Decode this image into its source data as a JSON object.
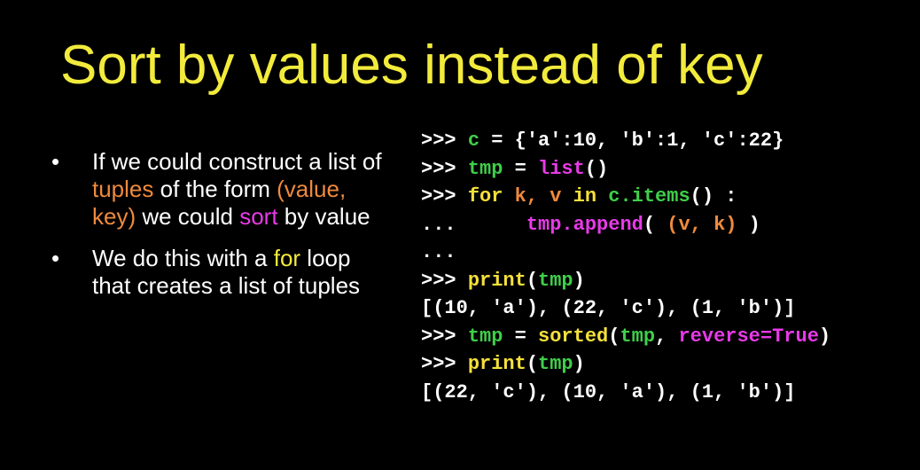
{
  "slide": {
    "title": "Sort by values instead of key",
    "bullets": [
      {
        "parts": [
          {
            "text": "If we could construct a list of ",
            "style": "plain"
          },
          {
            "text": "tuples",
            "style": "orange"
          },
          {
            "text": " of the form ",
            "style": "plain"
          },
          {
            "text": "(value, key)",
            "style": "orange"
          },
          {
            "text": " we could ",
            "style": "plain"
          },
          {
            "text": "sort",
            "style": "magenta"
          },
          {
            "text": " by value",
            "style": "plain"
          }
        ]
      },
      {
        "parts": [
          {
            "text": "We do this with a ",
            "style": "plain"
          },
          {
            "text": "for",
            "style": "yellow"
          },
          {
            "text": " loop that creates a list of tuples",
            "style": "plain"
          }
        ]
      }
    ],
    "bullet_symbol": "•",
    "code_lines": [
      [
        {
          "text": ">>> ",
          "color": "white"
        },
        {
          "text": "c",
          "color": "green"
        },
        {
          "text": " = {'a':10, 'b':1, 'c':22}",
          "color": "white"
        }
      ],
      [
        {
          "text": ">>> ",
          "color": "white"
        },
        {
          "text": "tmp",
          "color": "green"
        },
        {
          "text": " = ",
          "color": "white"
        },
        {
          "text": "list",
          "color": "magenta"
        },
        {
          "text": "()",
          "color": "white"
        }
      ],
      [
        {
          "text": ">>> ",
          "color": "white"
        },
        {
          "text": "for",
          "color": "yellow"
        },
        {
          "text": " ",
          "color": "white"
        },
        {
          "text": "k, v",
          "color": "orange"
        },
        {
          "text": " ",
          "color": "white"
        },
        {
          "text": "in",
          "color": "yellow"
        },
        {
          "text": " ",
          "color": "white"
        },
        {
          "text": "c.items",
          "color": "green"
        },
        {
          "text": "() :",
          "color": "white"
        }
      ],
      [
        {
          "text": "...      ",
          "color": "white"
        },
        {
          "text": "tmp.append",
          "color": "magenta"
        },
        {
          "text": "( ",
          "color": "white"
        },
        {
          "text": "(v, k)",
          "color": "orange"
        },
        {
          "text": " )",
          "color": "white"
        }
      ],
      [
        {
          "text": "...",
          "color": "white"
        }
      ],
      [
        {
          "text": ">>> ",
          "color": "white"
        },
        {
          "text": "print",
          "color": "yellow"
        },
        {
          "text": "(",
          "color": "white"
        },
        {
          "text": "tmp",
          "color": "green"
        },
        {
          "text": ")",
          "color": "white"
        }
      ],
      [
        {
          "text": "[(10, 'a'), (22, 'c'), (1, 'b')]",
          "color": "white"
        }
      ],
      [
        {
          "text": ">>> ",
          "color": "white"
        },
        {
          "text": "tmp",
          "color": "green"
        },
        {
          "text": " = ",
          "color": "white"
        },
        {
          "text": "sorted",
          "color": "yellow"
        },
        {
          "text": "(",
          "color": "white"
        },
        {
          "text": "tmp",
          "color": "green"
        },
        {
          "text": ", ",
          "color": "white"
        },
        {
          "text": "reverse=True",
          "color": "magenta"
        },
        {
          "text": ")",
          "color": "white"
        }
      ],
      [
        {
          "text": ">>> ",
          "color": "white"
        },
        {
          "text": "print",
          "color": "yellow"
        },
        {
          "text": "(",
          "color": "white"
        },
        {
          "text": "tmp",
          "color": "green"
        },
        {
          "text": ")",
          "color": "white"
        }
      ],
      [
        {
          "text": "[(22, 'c'), (10, 'a'), (1, 'b')]",
          "color": "white"
        }
      ]
    ]
  },
  "colors": {
    "background": "#000000",
    "title": "#f2eb3c",
    "body_text": "#ffffff",
    "highlight_orange": "#ef8a3c",
    "highlight_magenta": "#e83ae8",
    "highlight_yellow": "#f2eb3c",
    "code_green": "#3fcf4a",
    "code_yellow": "#f5e03a"
  }
}
